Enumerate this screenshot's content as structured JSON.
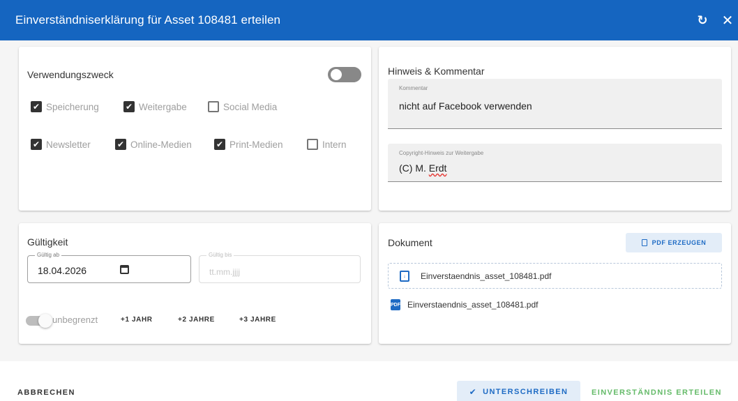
{
  "dialog": {
    "title": "Einverständniserklärung für Asset 108481 erteilen",
    "refresh_icon": "refresh-icon",
    "close_icon": "close-icon"
  },
  "usage": {
    "title": "Verwendungszweck",
    "toggle_on": false,
    "checkboxes": [
      {
        "label": "Speicherung",
        "checked": true
      },
      {
        "label": "Weitergabe",
        "checked": true
      },
      {
        "label": "Social Media",
        "checked": false
      },
      {
        "label": "Newsletter",
        "checked": true
      },
      {
        "label": "Online-Medien",
        "checked": true
      },
      {
        "label": "Print-Medien",
        "checked": true
      },
      {
        "label": "Intern",
        "checked": false
      }
    ]
  },
  "notes": {
    "title": "Hinweis & Kommentar",
    "comment_label": "Kommentar",
    "comment_value": "nicht auf Facebook verwenden",
    "copyright_label": "Copyright-Hinweis zur Weitergabe",
    "copyright_prefix": "(C) M. ",
    "copyright_name": "Erdt"
  },
  "validity": {
    "title": "Gültigkeit",
    "from_label": "Gültig ab",
    "from_value": "18.04.2026",
    "to_label": "Gültig bis",
    "to_placeholder": "tt.mm.jjjj",
    "unlimited_label": "unbegrenzt",
    "plus1": "+1 JAHR",
    "plus2": "+2 JAHRE",
    "plus3": "+3 JAHRE"
  },
  "document": {
    "title": "Dokument",
    "pdf_button": "PDF ERZEUGEN",
    "file_upload": "Einverstaendnis_asset_108481.pdf",
    "file_link": "Einverstaendnis_asset_108481.pdf"
  },
  "footer": {
    "cancel": "ABBRECHEN",
    "sign": "UNTERSCHREIBEN",
    "grant": "EINVERSTÄNDNIS ERTEILEN"
  },
  "colors": {
    "header_blue": "#1565c0",
    "accent_blue": "#1e6bc4",
    "grant_green": "#66bb6a"
  }
}
